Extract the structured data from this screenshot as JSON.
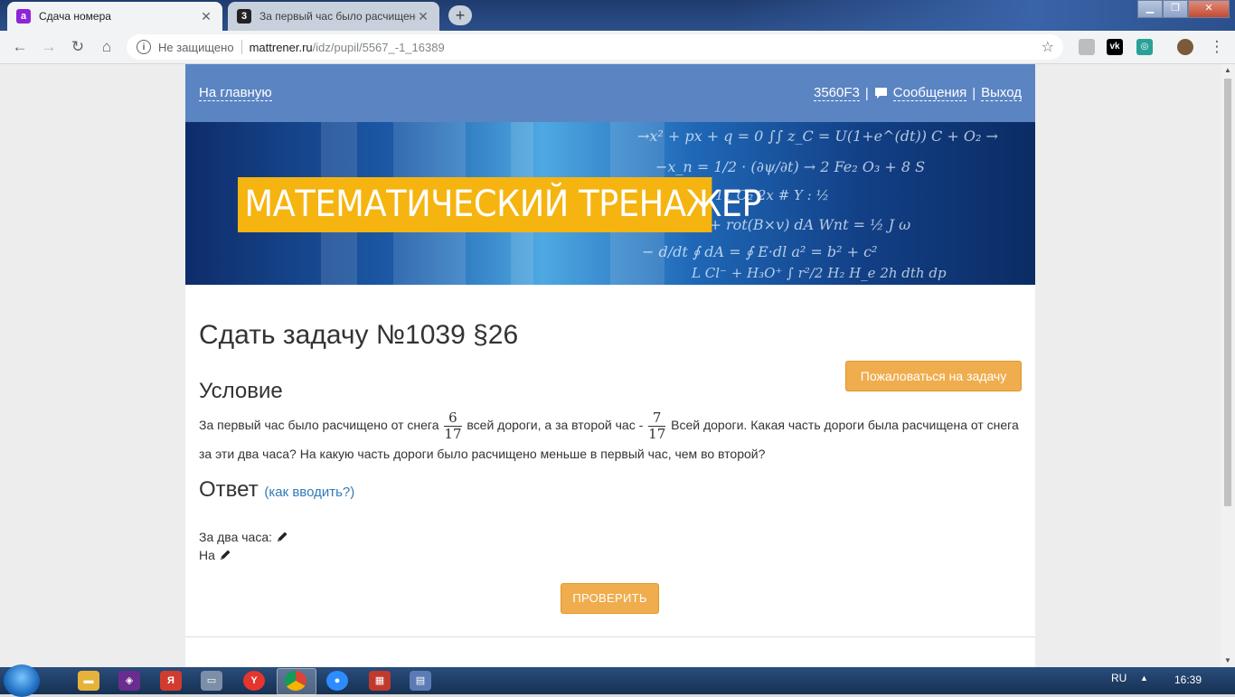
{
  "browser": {
    "tabs": [
      {
        "title": "Сдача номера",
        "active": true,
        "favicon_letter": "a",
        "favicon_color": "#8e24d8"
      },
      {
        "title": "За первый час было расчищено",
        "active": false,
        "favicon_letter": "3",
        "favicon_color": "#222222"
      }
    ],
    "security_label": "Не защищено",
    "url_host": "mattrener.ru",
    "url_path": "/idz/pupil/5567_-1_16389"
  },
  "nav": {
    "home_link": "На главную",
    "user_code": "3560F3",
    "divider": "|",
    "messages_link": "Сообщения",
    "logout_link": "Выход"
  },
  "banner": {
    "logo_text": "МАТЕМАТИЧЕСКИЙ ТРЕНАЖЕР"
  },
  "task": {
    "title": "Сдать задачу №1039 §26",
    "complain_button": "Пожаловаться на задачу",
    "condition_heading": "Условие",
    "condition_part1": "За первый час было расчищено от снега",
    "fraction1": {
      "num": "6",
      "den": "17"
    },
    "condition_part2": "всей дороги, а за второй час -",
    "fraction2": {
      "num": "7",
      "den": "17"
    },
    "condition_part3": "Всей дороги. Какая часть дороги была расчищена от снега за эти два часа? На какую часть дороги было расчищено меньше в первый час, чем во второй?",
    "answer_heading": "Ответ",
    "answer_hint": "(как вводить?)",
    "answer_line1": "За два часа:",
    "answer_line2": "На",
    "check_button": "ПРОВЕРИТЬ"
  },
  "taskbar": {
    "lang": "RU",
    "clock": "16:39"
  },
  "colors": {
    "nav_bg": "#5b84c3",
    "accent_button": "#efad4d",
    "logo_bg": "#f5b40f",
    "link": "#337ab7"
  }
}
